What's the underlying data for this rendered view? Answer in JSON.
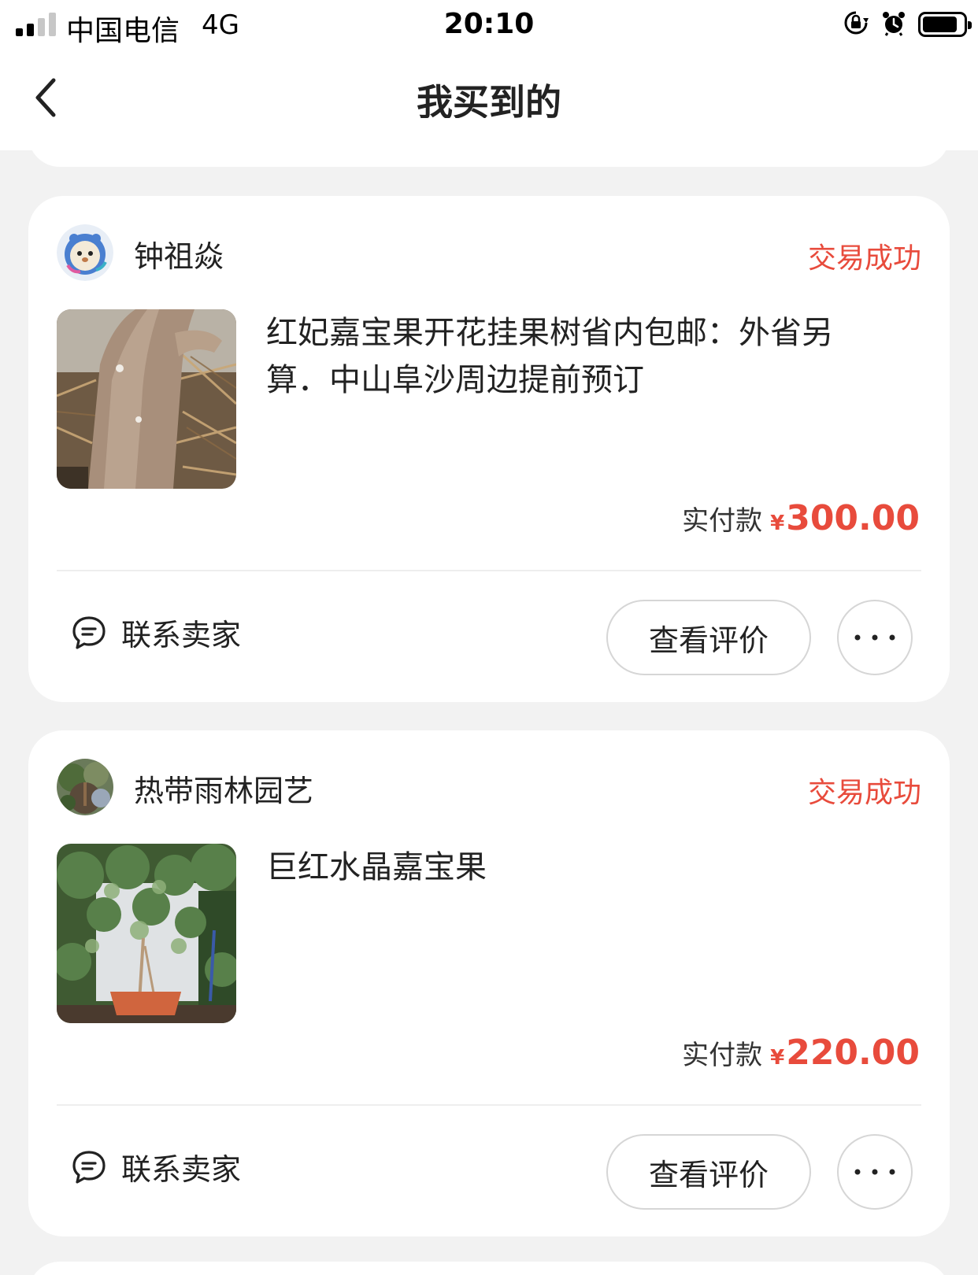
{
  "status_bar": {
    "carrier": "中国电信",
    "network": "4G",
    "time": "20:10"
  },
  "nav": {
    "title": "我买到的"
  },
  "orders": [
    {
      "seller": "钟祖焱",
      "status": "交易成功",
      "title": "红妃嘉宝果开花挂果树省内包邮：外省另算．中山阜沙周边提前预订",
      "price_label": "实付款",
      "currency": "¥",
      "price": "300.00",
      "contact_label": "联系卖家",
      "review_label": "查看评价"
    },
    {
      "seller": "热带雨林园艺",
      "status": "交易成功",
      "title": "巨红水晶嘉宝果",
      "price_label": "实付款",
      "currency": "¥",
      "price": "220.00",
      "contact_label": "联系卖家",
      "review_label": "查看评价"
    }
  ],
  "colors": {
    "accent": "#e84b3c",
    "background": "#f2f2f2",
    "card": "#ffffff"
  },
  "icons": [
    "signal-icon",
    "rotation-lock-icon",
    "alarm-icon",
    "battery-icon",
    "back-chevron-icon",
    "chat-bubble-icon",
    "more-dots-icon"
  ]
}
